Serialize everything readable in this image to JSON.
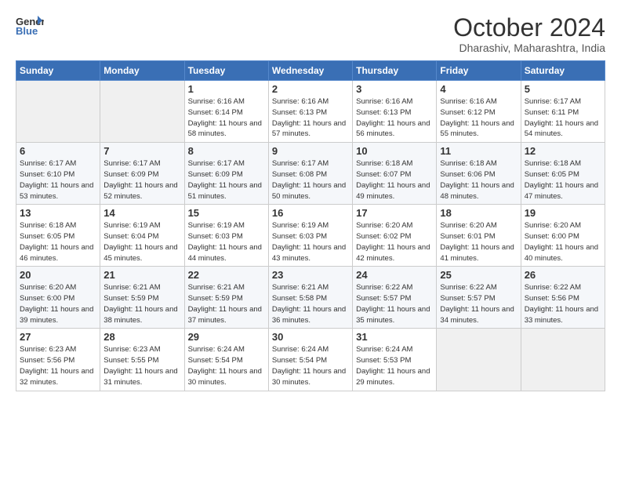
{
  "logo": {
    "general": "General",
    "blue": "Blue"
  },
  "header": {
    "month": "October 2024",
    "location": "Dharashiv, Maharashtra, India"
  },
  "days_of_week": [
    "Sunday",
    "Monday",
    "Tuesday",
    "Wednesday",
    "Thursday",
    "Friday",
    "Saturday"
  ],
  "weeks": [
    [
      {
        "day": "",
        "info": ""
      },
      {
        "day": "",
        "info": ""
      },
      {
        "day": "1",
        "info": "Sunrise: 6:16 AM\nSunset: 6:14 PM\nDaylight: 11 hours and 58 minutes."
      },
      {
        "day": "2",
        "info": "Sunrise: 6:16 AM\nSunset: 6:13 PM\nDaylight: 11 hours and 57 minutes."
      },
      {
        "day": "3",
        "info": "Sunrise: 6:16 AM\nSunset: 6:13 PM\nDaylight: 11 hours and 56 minutes."
      },
      {
        "day": "4",
        "info": "Sunrise: 6:16 AM\nSunset: 6:12 PM\nDaylight: 11 hours and 55 minutes."
      },
      {
        "day": "5",
        "info": "Sunrise: 6:17 AM\nSunset: 6:11 PM\nDaylight: 11 hours and 54 minutes."
      }
    ],
    [
      {
        "day": "6",
        "info": "Sunrise: 6:17 AM\nSunset: 6:10 PM\nDaylight: 11 hours and 53 minutes."
      },
      {
        "day": "7",
        "info": "Sunrise: 6:17 AM\nSunset: 6:09 PM\nDaylight: 11 hours and 52 minutes."
      },
      {
        "day": "8",
        "info": "Sunrise: 6:17 AM\nSunset: 6:09 PM\nDaylight: 11 hours and 51 minutes."
      },
      {
        "day": "9",
        "info": "Sunrise: 6:17 AM\nSunset: 6:08 PM\nDaylight: 11 hours and 50 minutes."
      },
      {
        "day": "10",
        "info": "Sunrise: 6:18 AM\nSunset: 6:07 PM\nDaylight: 11 hours and 49 minutes."
      },
      {
        "day": "11",
        "info": "Sunrise: 6:18 AM\nSunset: 6:06 PM\nDaylight: 11 hours and 48 minutes."
      },
      {
        "day": "12",
        "info": "Sunrise: 6:18 AM\nSunset: 6:05 PM\nDaylight: 11 hours and 47 minutes."
      }
    ],
    [
      {
        "day": "13",
        "info": "Sunrise: 6:18 AM\nSunset: 6:05 PM\nDaylight: 11 hours and 46 minutes."
      },
      {
        "day": "14",
        "info": "Sunrise: 6:19 AM\nSunset: 6:04 PM\nDaylight: 11 hours and 45 minutes."
      },
      {
        "day": "15",
        "info": "Sunrise: 6:19 AM\nSunset: 6:03 PM\nDaylight: 11 hours and 44 minutes."
      },
      {
        "day": "16",
        "info": "Sunrise: 6:19 AM\nSunset: 6:03 PM\nDaylight: 11 hours and 43 minutes."
      },
      {
        "day": "17",
        "info": "Sunrise: 6:20 AM\nSunset: 6:02 PM\nDaylight: 11 hours and 42 minutes."
      },
      {
        "day": "18",
        "info": "Sunrise: 6:20 AM\nSunset: 6:01 PM\nDaylight: 11 hours and 41 minutes."
      },
      {
        "day": "19",
        "info": "Sunrise: 6:20 AM\nSunset: 6:00 PM\nDaylight: 11 hours and 40 minutes."
      }
    ],
    [
      {
        "day": "20",
        "info": "Sunrise: 6:20 AM\nSunset: 6:00 PM\nDaylight: 11 hours and 39 minutes."
      },
      {
        "day": "21",
        "info": "Sunrise: 6:21 AM\nSunset: 5:59 PM\nDaylight: 11 hours and 38 minutes."
      },
      {
        "day": "22",
        "info": "Sunrise: 6:21 AM\nSunset: 5:59 PM\nDaylight: 11 hours and 37 minutes."
      },
      {
        "day": "23",
        "info": "Sunrise: 6:21 AM\nSunset: 5:58 PM\nDaylight: 11 hours and 36 minutes."
      },
      {
        "day": "24",
        "info": "Sunrise: 6:22 AM\nSunset: 5:57 PM\nDaylight: 11 hours and 35 minutes."
      },
      {
        "day": "25",
        "info": "Sunrise: 6:22 AM\nSunset: 5:57 PM\nDaylight: 11 hours and 34 minutes."
      },
      {
        "day": "26",
        "info": "Sunrise: 6:22 AM\nSunset: 5:56 PM\nDaylight: 11 hours and 33 minutes."
      }
    ],
    [
      {
        "day": "27",
        "info": "Sunrise: 6:23 AM\nSunset: 5:56 PM\nDaylight: 11 hours and 32 minutes."
      },
      {
        "day": "28",
        "info": "Sunrise: 6:23 AM\nSunset: 5:55 PM\nDaylight: 11 hours and 31 minutes."
      },
      {
        "day": "29",
        "info": "Sunrise: 6:24 AM\nSunset: 5:54 PM\nDaylight: 11 hours and 30 minutes."
      },
      {
        "day": "30",
        "info": "Sunrise: 6:24 AM\nSunset: 5:54 PM\nDaylight: 11 hours and 30 minutes."
      },
      {
        "day": "31",
        "info": "Sunrise: 6:24 AM\nSunset: 5:53 PM\nDaylight: 11 hours and 29 minutes."
      },
      {
        "day": "",
        "info": ""
      },
      {
        "day": "",
        "info": ""
      }
    ]
  ]
}
